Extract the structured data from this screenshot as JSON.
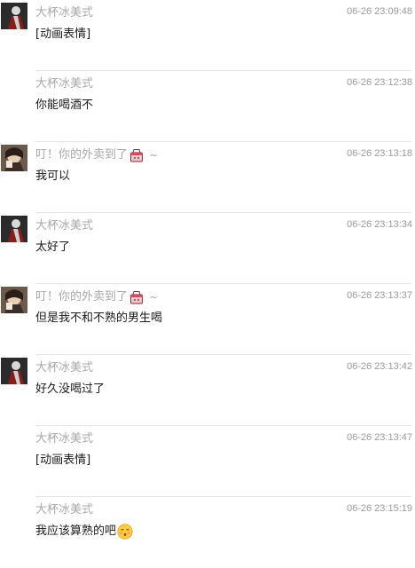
{
  "messages": [
    {
      "sender": "大杯冰美式",
      "time": "06-26 23:09:48",
      "content": "[动画表情]",
      "avatar": "avatar-a"
    },
    {
      "sender": "大杯冰美式",
      "time": "06-26 23:12:38",
      "content": "你能喝酒不",
      "avatar": null
    },
    {
      "sender": "叮！你的外卖到了",
      "sender_emoji": "takeout-box-icon",
      "sender_suffix": "~",
      "time": "06-26 23:13:18",
      "content": "我可以",
      "avatar": "avatar-b"
    },
    {
      "sender": "大杯冰美式",
      "time": "06-26 23:13:34",
      "content": "太好了",
      "avatar": "avatar-a"
    },
    {
      "sender": "叮！你的外卖到了",
      "sender_emoji": "takeout-box-icon",
      "sender_suffix": "~",
      "time": "06-26 23:13:37",
      "content": "但是我不和不熟的男生喝",
      "avatar": "avatar-b"
    },
    {
      "sender": "大杯冰美式",
      "time": "06-26 23:13:42",
      "content": "好久没喝过了",
      "avatar": "avatar-a"
    },
    {
      "sender": "大杯冰美式",
      "time": "06-26 23:13:47",
      "content": "[动画表情]",
      "avatar": null
    },
    {
      "sender": "大杯冰美式",
      "time": "06-26 23:15:19",
      "content": "我应该算熟的吧",
      "content_emoji": "blushing-face-icon",
      "avatar": null
    }
  ],
  "colors": {
    "sender_text": "#a8a8a8",
    "time_text": "#9a9a9a",
    "content_text": "#1a1a1a",
    "divider": "#e6e6e6"
  }
}
